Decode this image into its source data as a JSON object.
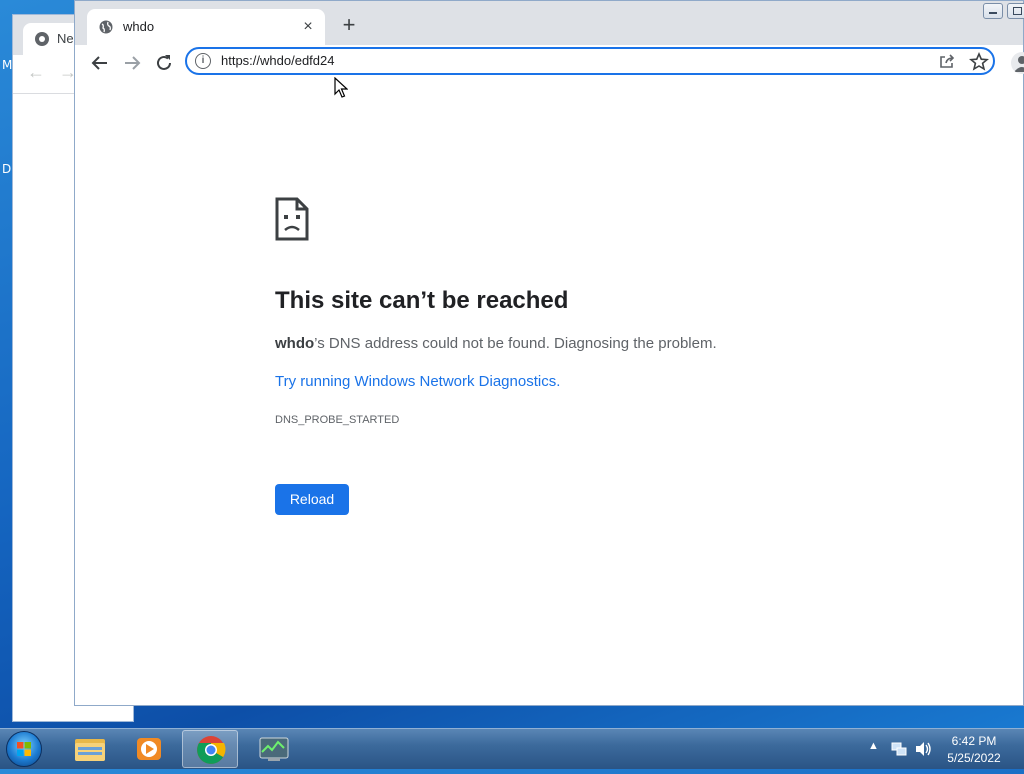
{
  "desktop": {
    "left_fragment_1": "M",
    "left_fragment_2": "D"
  },
  "background_window": {
    "tab_title": "Ne"
  },
  "browser": {
    "tab": {
      "title": "whdo",
      "close_glyph": "×"
    },
    "new_tab_glyph": "+",
    "address_bar": {
      "url": "https://whdo/edfd24"
    },
    "error_page": {
      "heading": "This site can’t be reached",
      "host": "whdo",
      "message_rest": "’s DNS address could not be found. Diagnosing the problem.",
      "diagnostics_link": "Try running Windows Network Diagnostics.",
      "error_code": "DNS_PROBE_STARTED",
      "reload_label": "Reload"
    }
  },
  "taskbar": {
    "apps": [
      "windows-explorer",
      "media-player",
      "google-chrome",
      "task-manager"
    ],
    "active_app": "google-chrome",
    "clock": {
      "time": "6:42 PM",
      "date": "5/25/2022"
    }
  },
  "colors": {
    "accent": "#1a73e8",
    "heading": "#202124",
    "body_text": "#5f6368"
  }
}
